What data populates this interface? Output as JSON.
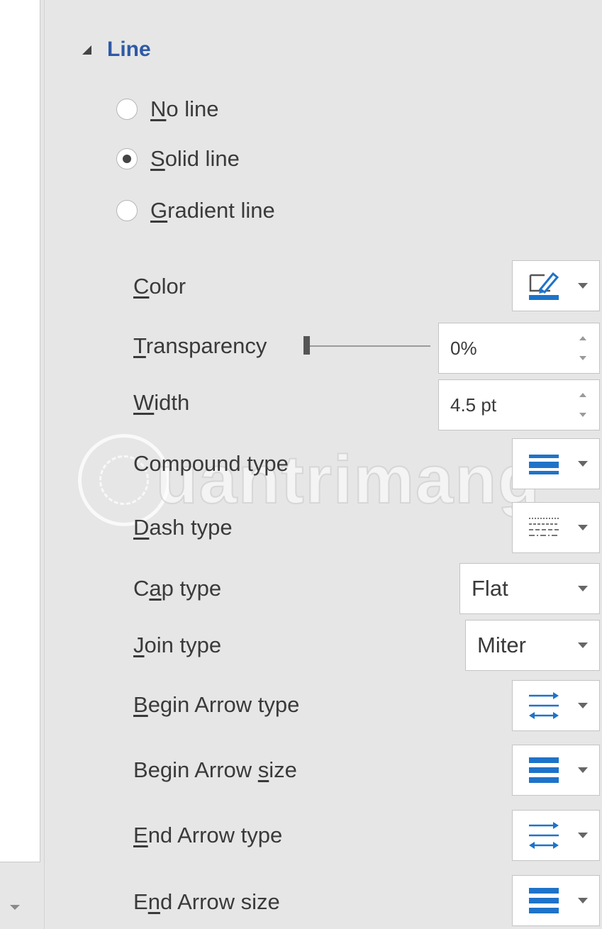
{
  "section": {
    "title": "Line"
  },
  "line_options": [
    {
      "prefix": "",
      "accel": "N",
      "rest": "o line",
      "checked": false
    },
    {
      "prefix": "",
      "accel": "S",
      "rest": "olid line",
      "checked": true
    },
    {
      "prefix": "",
      "accel": "G",
      "rest": "radient line",
      "checked": false
    }
  ],
  "properties": {
    "color": {
      "accel": "C",
      "rest": "olor",
      "icon": "pen-color-icon"
    },
    "transparency": {
      "accel": "T",
      "rest": "ransparency",
      "value": "0%",
      "level": 0
    },
    "width": {
      "accel": "W",
      "rest": "idth",
      "value": "4.5 pt"
    },
    "compound_type": {
      "prefix": "Compound type",
      "icon": "compound-lines-icon"
    },
    "dash_type": {
      "accel": "D",
      "rest": "ash type",
      "icon": "dash-lines-icon"
    },
    "cap_type": {
      "prefix": "C",
      "accel": "a",
      "rest": "p type",
      "value": "Flat"
    },
    "join_type": {
      "accel": "J",
      "rest": "oin type",
      "value": "Miter"
    },
    "begin_arrow_type": {
      "accel": "B",
      "rest": "egin Arrow type",
      "icon": "arrow-type-icon"
    },
    "begin_arrow_size": {
      "prefix": "Begin Arrow ",
      "accel": "s",
      "rest": "ize",
      "icon": "arrow-size-icon"
    },
    "end_arrow_type": {
      "accel": "E",
      "rest": "nd Arrow type",
      "icon": "arrow-type-icon"
    },
    "end_arrow_size": {
      "prefix": "E",
      "accel": "n",
      "rest": "d Arrow size",
      "icon": "arrow-size-icon"
    }
  },
  "watermark": {
    "text": "uantrimang"
  },
  "colors": {
    "accent": "#2d5aa6",
    "icon_blue": "#1e73c9",
    "panel_bg": "#e6e6e6"
  }
}
